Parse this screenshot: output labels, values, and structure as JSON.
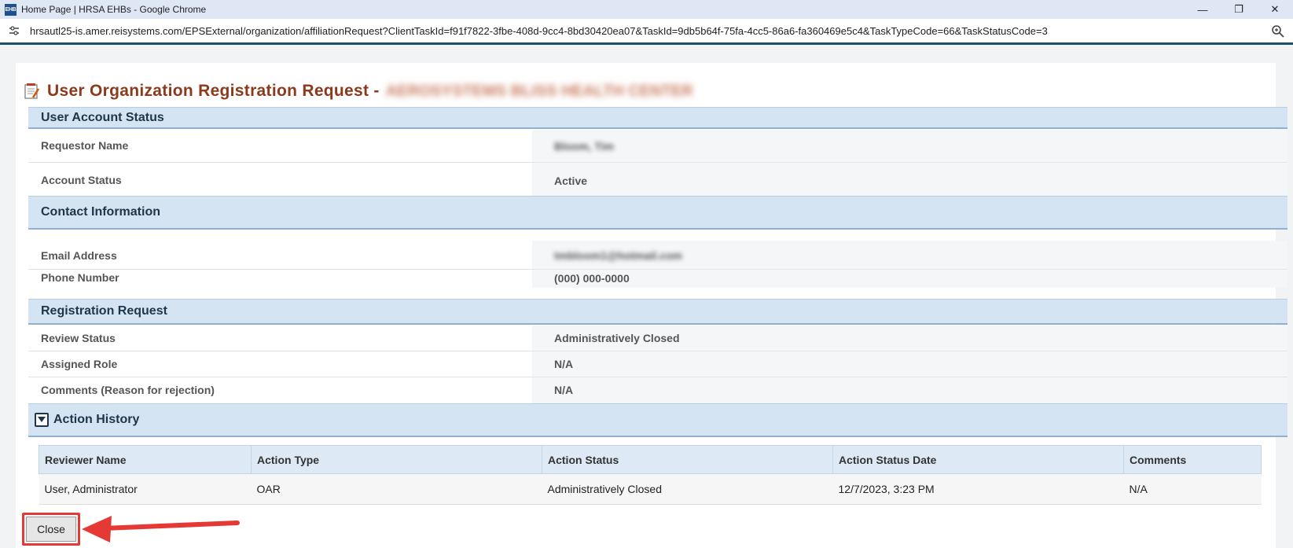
{
  "browser": {
    "window_title": "Home Page | HRSA EHBs - Google Chrome",
    "favicon_text": "EHB",
    "url": "hrsautl25-is.amer.reisystems.com/EPSExternal/organization/affiliationRequest?ClientTaskId=f91f7822-3fbe-408d-9cc4-8bd30420ea07&TaskId=9db5b64f-75fa-4cc5-86a6-fa360469e5c4&TaskTypeCode=66&TaskStatusCode=3",
    "controls": {
      "minimize": "—",
      "restore": "❐",
      "close": "✕"
    }
  },
  "page": {
    "title": "User Organization Registration Request -",
    "title_org_blurred": "AEROSYSTEMS BLISS HEALTH CENTER"
  },
  "sections": {
    "account": {
      "title": "User Account Status",
      "rows": [
        {
          "label": "Requestor Name",
          "value": "Bloom, Tim"
        },
        {
          "label": "Account Status",
          "value": "Active"
        }
      ]
    },
    "contact": {
      "title": "Contact Information",
      "rows": [
        {
          "label": "Email Address",
          "value": "tmbloom1@hotmail.com"
        },
        {
          "label": "Phone Number",
          "value": "(000) 000-0000"
        }
      ]
    },
    "registration": {
      "title": "Registration Request",
      "rows": [
        {
          "label": "Review Status",
          "value": "Administratively Closed"
        },
        {
          "label": "Assigned Role",
          "value": "N/A"
        },
        {
          "label": "Comments (Reason for rejection)",
          "value": "N/A"
        }
      ]
    },
    "history": {
      "title": "Action History",
      "columns": [
        "Reviewer Name",
        "Action Type",
        "Action Status",
        "Action Status Date",
        "Comments"
      ],
      "rows": [
        [
          "User, Administrator",
          "OAR",
          "Administratively Closed",
          "12/7/2023, 3:23 PM",
          "N/A"
        ]
      ]
    }
  },
  "buttons": {
    "close": "Close"
  },
  "colors": {
    "title": "#8b3a1c",
    "section_bg": "#d5e4f2",
    "highlight": "#e53935"
  }
}
